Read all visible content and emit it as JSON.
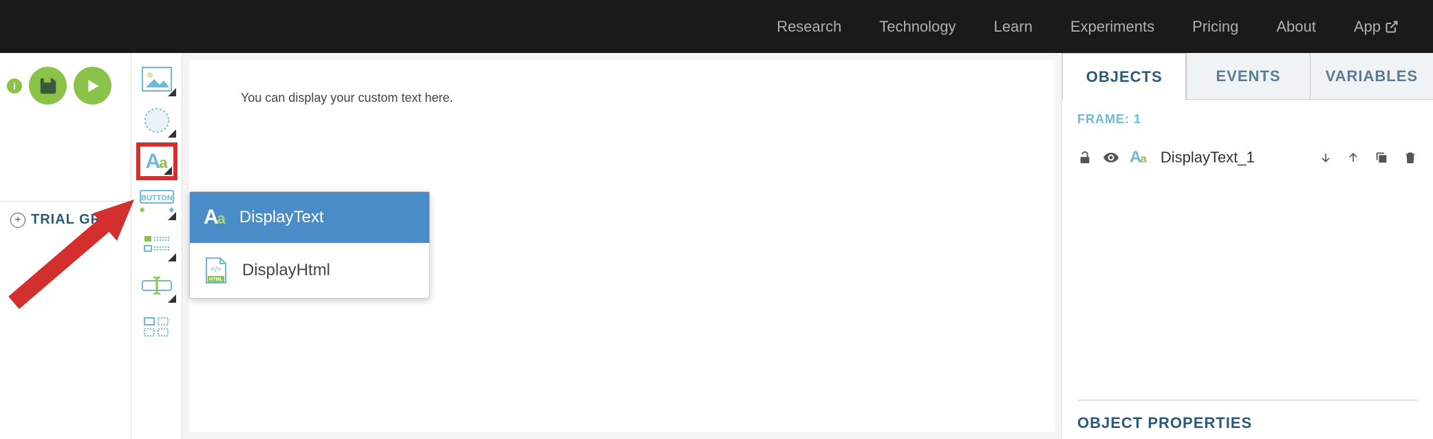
{
  "nav": {
    "items": [
      "Research",
      "Technology",
      "Learn",
      "Experiments",
      "Pricing",
      "About",
      "App"
    ]
  },
  "toolbar": {
    "info_label": "i"
  },
  "sidebar": {
    "trial_group_label": "TRIAL GR"
  },
  "tools": {
    "image": "image-tool",
    "circle": "circle-tool",
    "text": "text-tool",
    "button": "button-tool",
    "list": "list-tool",
    "input": "input-tool",
    "grid": "grid-tool",
    "button_label": "BUTTON"
  },
  "flyout": {
    "items": [
      {
        "label": "DisplayText",
        "selected": true
      },
      {
        "label": "DisplayHtml",
        "selected": false
      }
    ],
    "html_badge": "HTML"
  },
  "canvas": {
    "placeholder_text": "You can display your custom text here."
  },
  "tabs": {
    "objects": "OBJECTS",
    "events": "EVENTS",
    "variables": "VARIABLES"
  },
  "panel": {
    "frame_label": "FRAME: 1",
    "objects": [
      {
        "name": "DisplayText_1"
      }
    ],
    "object_properties_title": "OBJECT PROPERTIES"
  }
}
